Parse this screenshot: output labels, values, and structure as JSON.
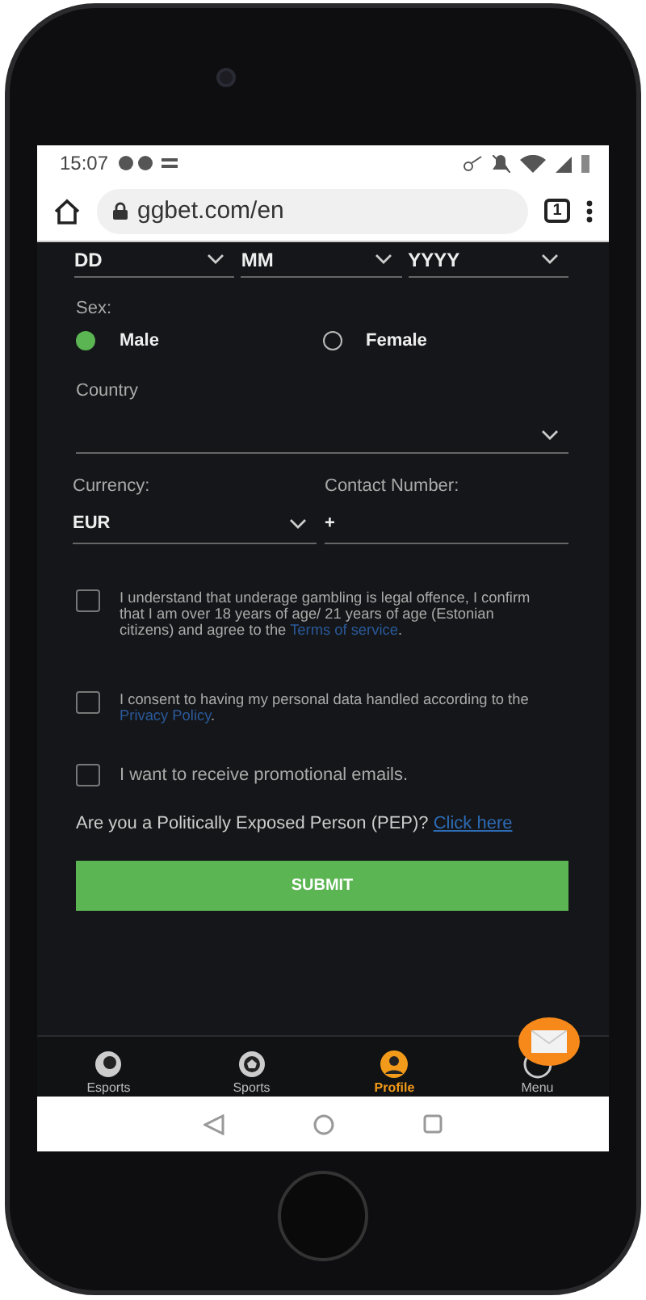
{
  "status_bar": {
    "time": "15:07"
  },
  "browser": {
    "url": "ggbet.com/en",
    "tab_count": "1"
  },
  "form": {
    "date_fields": [
      {
        "value": "DD"
      },
      {
        "value": "MM"
      },
      {
        "value": "YYYY"
      }
    ],
    "sex": {
      "label": "Sex:",
      "options": [
        {
          "label": "Male",
          "selected": true
        },
        {
          "label": "Female",
          "selected": false
        }
      ]
    },
    "country": {
      "placeholder": "Country"
    },
    "currency": {
      "label": "Currency:",
      "value": "EUR"
    },
    "contact": {
      "label": "Contact Number:",
      "value": "+"
    },
    "checkboxes": [
      {
        "text": "I understand that underage gambling is legal offence, I confirm that I am over 18 years of age/ 21 years of age (Estonian citizens) and agree to the ",
        "link": "Terms of service",
        "after": ".",
        "checked": false
      },
      {
        "text": "I consent to having my personal data handled according to the ",
        "link": "Privacy Policy",
        "after": ".",
        "checked": false
      },
      {
        "text": "I want to receive promotional emails.",
        "checked": false
      }
    ],
    "pep": {
      "text": "Are you a Politically Exposed Person (PEP)? ",
      "link": "Click here"
    },
    "submit": "SUBMIT"
  },
  "bottom_nav": [
    {
      "label": "Esports",
      "kind": "esports",
      "selected": false
    },
    {
      "label": "Sports",
      "kind": "sports",
      "selected": false
    },
    {
      "label": "Profile",
      "kind": "profile",
      "selected": true
    },
    {
      "label": "Menu",
      "kind": "menu",
      "selected": false
    }
  ]
}
